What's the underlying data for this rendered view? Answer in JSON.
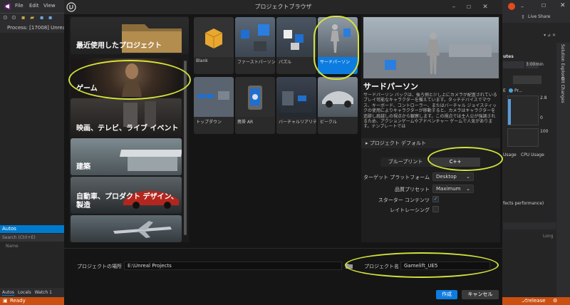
{
  "vs": {
    "menu": [
      "File",
      "Edit",
      "View"
    ],
    "process_label": "Process:",
    "process_value": "[17008] UnrealEdit",
    "live_share": "Live Share",
    "autos": {
      "header": "Autos",
      "search_placeholder": "Search (Ctrl+E)",
      "name_col": "Name"
    },
    "bottom_tabs": [
      "Autos",
      "Locals",
      "Watch 1"
    ],
    "status": "Ready",
    "status_branch": "release",
    "right_panel": {
      "utes": "utes",
      "time": "3:00min",
      "legend_e": "E",
      "legend_pr": "Pr...",
      "val_28": "2.8",
      "val_0": "0",
      "val_100": "100",
      "usage": "Usage",
      "cpu_usage": "CPU Usage",
      "fects": "fects performance)",
      "long": "Long",
      "sol_explorer": "Solution Explorer",
      "git_changes": "Git Changes"
    }
  },
  "dialog": {
    "title": "プロジェクトブラウザ",
    "categories": [
      {
        "label": "最近使用したプロジェクト"
      },
      {
        "label": "ゲーム"
      },
      {
        "label": "映画、テレビ、ライブ イベント"
      },
      {
        "label": "建築"
      },
      {
        "label": "自動車、プロダクト デザイン、製造"
      }
    ],
    "templates": [
      {
        "label": "Blank"
      },
      {
        "label": "ファーストパーソン"
      },
      {
        "label": "パズル"
      },
      {
        "label": "サードパーソン"
      },
      {
        "label": "トップダウン"
      },
      {
        "label": "携帯 AR"
      },
      {
        "label": "バーチャルリアリティ"
      },
      {
        "label": "ビークル"
      }
    ],
    "detail": {
      "title": "サードパーソン",
      "description": "サードパーソン パックは、後ろ側と少し上にカメラが配置されているプレイ可能なキャラクターを備えています。タッチデバイスでマウス、キーボード、コントローラー、またはバーチャル ジョイスティックの使用によりキャラクターが移動すると、カメラはキャラクターを追跡し肩越しの視点から観察します。この視点では主人公が強調されるため、アクションゲームやアドベンチャー ゲームで人気があります。テンプレートでは"
    },
    "defaults": {
      "header": "プロジェクト デフォルト",
      "blueprint": "ブループリント",
      "cpp": "C++",
      "platform_label": "ターゲット プラットフォーム",
      "platform_value": "Desktop",
      "quality_label": "品質プリセット",
      "quality_value": "Maximum",
      "starter_label": "スターター コンテンツ",
      "raytracing_label": "レイトレーシング"
    },
    "footer": {
      "location_label": "プロジェクトの場所",
      "location_value": "E:\\Unreal Projects",
      "name_label": "プロジェクト名",
      "name_value": "Gamelift_UE5",
      "create": "作成",
      "cancel": "キャンセル"
    }
  },
  "colors": {
    "accent": "#0d7ce0",
    "highlight": "#d4e23a",
    "vs_status": "#ca5010",
    "vs_blue": "#007acc"
  },
  "icons": [
    "visual-studio-logo-icon",
    "unreal-logo-icon",
    "folder-icon",
    "checkmark-icon",
    "chevron-down-icon"
  ]
}
